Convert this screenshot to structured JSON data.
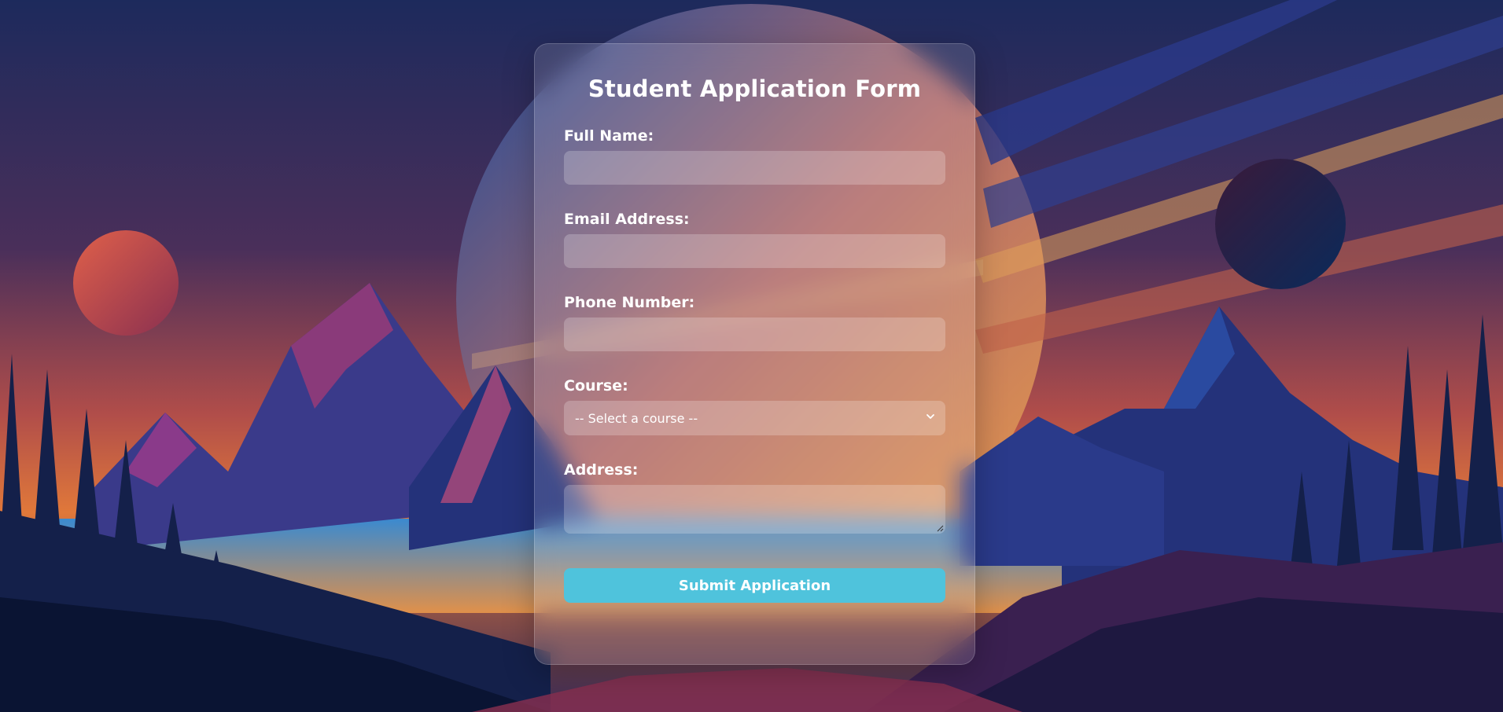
{
  "form": {
    "title": "Student Application Form",
    "fields": {
      "full_name": {
        "label": "Full Name:",
        "value": ""
      },
      "email": {
        "label": "Email Address:",
        "value": ""
      },
      "phone": {
        "label": "Phone Number:",
        "value": ""
      },
      "course": {
        "label": "Course:",
        "selected": "-- Select a course --"
      },
      "address": {
        "label": "Address:",
        "value": ""
      }
    },
    "submit_label": "Submit Application"
  },
  "colors": {
    "accent": "#4fc3dc",
    "sky_top": "#1f2a5a",
    "sky_mid": "#8a3f55",
    "sky_horizon": "#e07a3c"
  }
}
